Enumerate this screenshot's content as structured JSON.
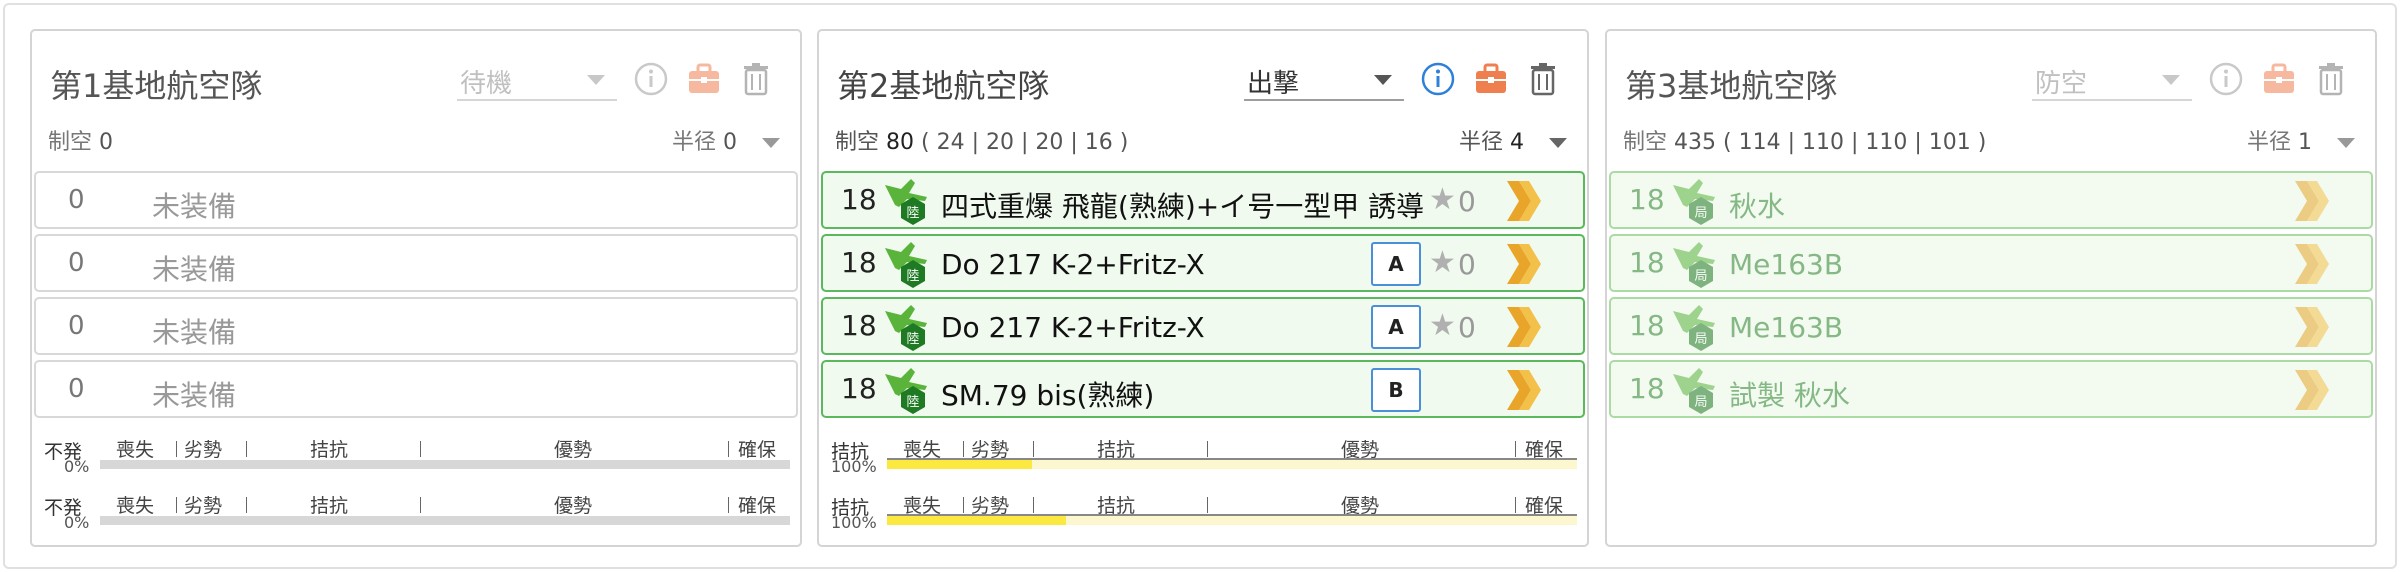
{
  "colors": {
    "equipped_border": "#5cb85c",
    "info_blue": "#2f80d9",
    "briefcase": "#f07f50",
    "bar_yellow": "#fbe940",
    "bar_gray": "#d7d7d7",
    "rank_border": "#4a90d9"
  },
  "corps": [
    {
      "title": "第1基地航空隊",
      "mode": "待機",
      "air_label": "制空",
      "air_value": "0",
      "air_breakdown": "",
      "radius_label": "半径",
      "radius_value": "0",
      "icons": [
        "info-icon",
        "briefcase-icon",
        "trash-icon"
      ],
      "slots": [
        {
          "count": "0",
          "name": "未装備",
          "equipped": false
        },
        {
          "count": "0",
          "name": "未装備",
          "equipped": false
        },
        {
          "count": "0",
          "name": "未装備",
          "equipped": false
        },
        {
          "count": "0",
          "name": "未装備",
          "equipped": false
        }
      ],
      "bars": [
        {
          "status": "不発",
          "percent": "0%",
          "fill": 0
        },
        {
          "status": "不発",
          "percent": "0%",
          "fill": 0
        }
      ]
    },
    {
      "title": "第2基地航空隊",
      "mode": "出撃",
      "air_label": "制空",
      "air_value": "80",
      "air_breakdown": "( 24 | 20 | 20 | 16 )",
      "radius_label": "半径",
      "radius_value": "4",
      "icons": [
        "info-icon",
        "briefcase-icon",
        "trash-icon"
      ],
      "slots": [
        {
          "count": "18",
          "name": "四式重爆 飛龍(熟練)+イ号一型甲 誘導",
          "equipped": true,
          "type_icon": "陸",
          "rank": "",
          "star": "★",
          "improvement": "0"
        },
        {
          "count": "18",
          "name": "Do 217 K-2+Fritz-X",
          "equipped": true,
          "type_icon": "陸",
          "rank": "A",
          "star": "★",
          "improvement": "0"
        },
        {
          "count": "18",
          "name": "Do 217 K-2+Fritz-X",
          "equipped": true,
          "type_icon": "陸",
          "rank": "A",
          "star": "★",
          "improvement": "0"
        },
        {
          "count": "18",
          "name": "SM.79 bis(熟練)",
          "equipped": true,
          "type_icon": "陸",
          "rank": "B",
          "star": "",
          "improvement": ""
        }
      ],
      "bars": [
        {
          "status": "拮抗",
          "percent": "100%",
          "fill": 0.21
        },
        {
          "status": "拮抗",
          "percent": "100%",
          "fill": 0.26
        }
      ]
    },
    {
      "title": "第3基地航空隊",
      "mode": "防空",
      "air_label": "制空",
      "air_value": "435",
      "air_breakdown": "( 114 | 110 | 110 | 101 )",
      "radius_label": "半径",
      "radius_value": "1",
      "icons": [
        "info-icon",
        "briefcase-icon",
        "trash-icon"
      ],
      "slots": [
        {
          "count": "18",
          "name": "秋水",
          "equipped": true,
          "type_icon": "局"
        },
        {
          "count": "18",
          "name": "Me163B",
          "equipped": true,
          "type_icon": "局"
        },
        {
          "count": "18",
          "name": "Me163B",
          "equipped": true,
          "type_icon": "局"
        },
        {
          "count": "18",
          "name": "試製 秋水",
          "equipped": true,
          "type_icon": "局"
        }
      ],
      "bars": []
    }
  ],
  "scale_labels": [
    "喪失",
    "劣勢",
    "拮抗",
    "優勢",
    "確保"
  ]
}
